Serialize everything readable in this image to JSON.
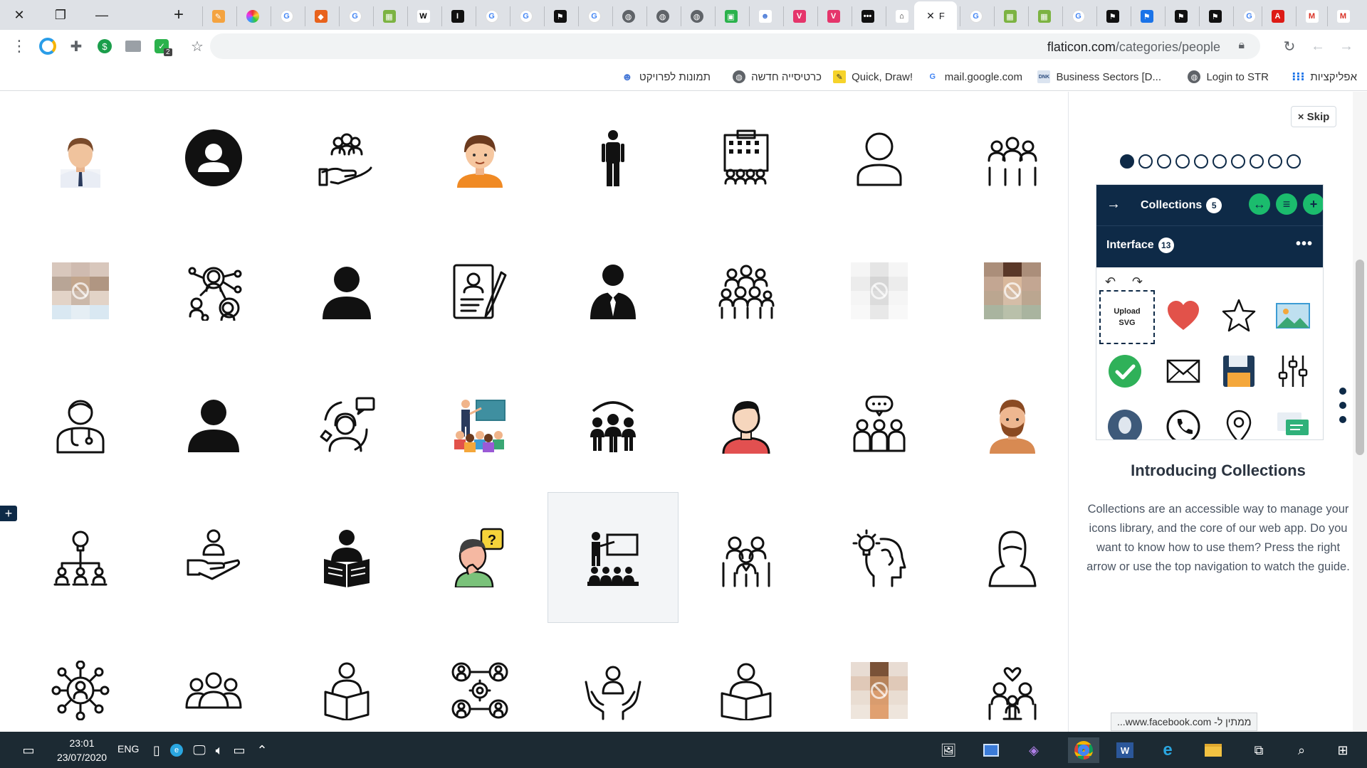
{
  "browser": {
    "url_domain": "flaticon.com",
    "url_path": "/categories/people",
    "active_tab_label": "F",
    "extension_badge": "2"
  },
  "bookmarks": [
    {
      "label": "אפליקציות",
      "icon": "apps-grid-icon"
    },
    {
      "label": "Login to STR",
      "icon": "globe-icon"
    },
    {
      "label": "Business Sectors [D...",
      "icon": "dnika-icon"
    },
    {
      "label": "mail.google.com",
      "icon": "google-icon"
    },
    {
      "label": "Quick, Draw!",
      "icon": "pencil-icon"
    },
    {
      "label": "כרטיסייה חדשה",
      "icon": "globe-icon"
    },
    {
      "label": "תמונות לפרויקט",
      "icon": "bot-icon"
    }
  ],
  "icon_grid": [
    "man-avatar-color",
    "user-circle-solid",
    "team-in-hand-outline",
    "boy-avatar-color",
    "man-standing-solid",
    "building-people-outline",
    "user-outline",
    "group-people-outline",
    "placeholder-image",
    "network-people-outline",
    "user-solid",
    "resume-pen-outline",
    "businessman-tie-solid",
    "crowd-outline",
    "placeholder-image",
    "placeholder-image",
    "doctor-outline",
    "user-solid-2",
    "customer-support-outline",
    "teacher-presentation-color",
    "team-wifi-solid",
    "man-avatar-red-shirt",
    "group-chat-outline",
    "bearded-man-color",
    "idea-network-outline",
    "user-in-hand-outline",
    "reading-person-solid",
    "thinking-boy-question-color",
    "teacher-board-solid",
    "business-team-outline",
    "brain-idea-head-outline",
    "woman-silhouette-outline",
    "user-network-outline",
    "group-outline",
    "reading-person-outline",
    "gear-people-outline",
    "hands-holding-person-outline",
    "reading-book-outline",
    "placeholder-image",
    "family-heart-outline"
  ],
  "side_panel": {
    "skip_label": "× Skip",
    "collections_label": "Collections",
    "collections_count": "5",
    "collection_name": "Interface",
    "collection_count": "13",
    "more_label": "•••",
    "upload_label_1": "Upload",
    "upload_label_2": "SVG",
    "intro_title": "Introducing Collections",
    "intro_body": "Collections are an accessible way to manage your icons library, and the core of our web app. Do you want to know how to use them? Press the right arrow or use the top navigation to watch the guide.",
    "step_total": 10,
    "step_current": 1
  },
  "status_url": "ממתין ל- www.facebook.com...",
  "taskbar": {
    "time": "23:01",
    "date": "23/07/2020",
    "lang": "ENG"
  },
  "colors": {
    "navy": "#0e2a47",
    "green": "#1bbc6d",
    "heart": "#e2524a",
    "check": "#2fb159"
  }
}
